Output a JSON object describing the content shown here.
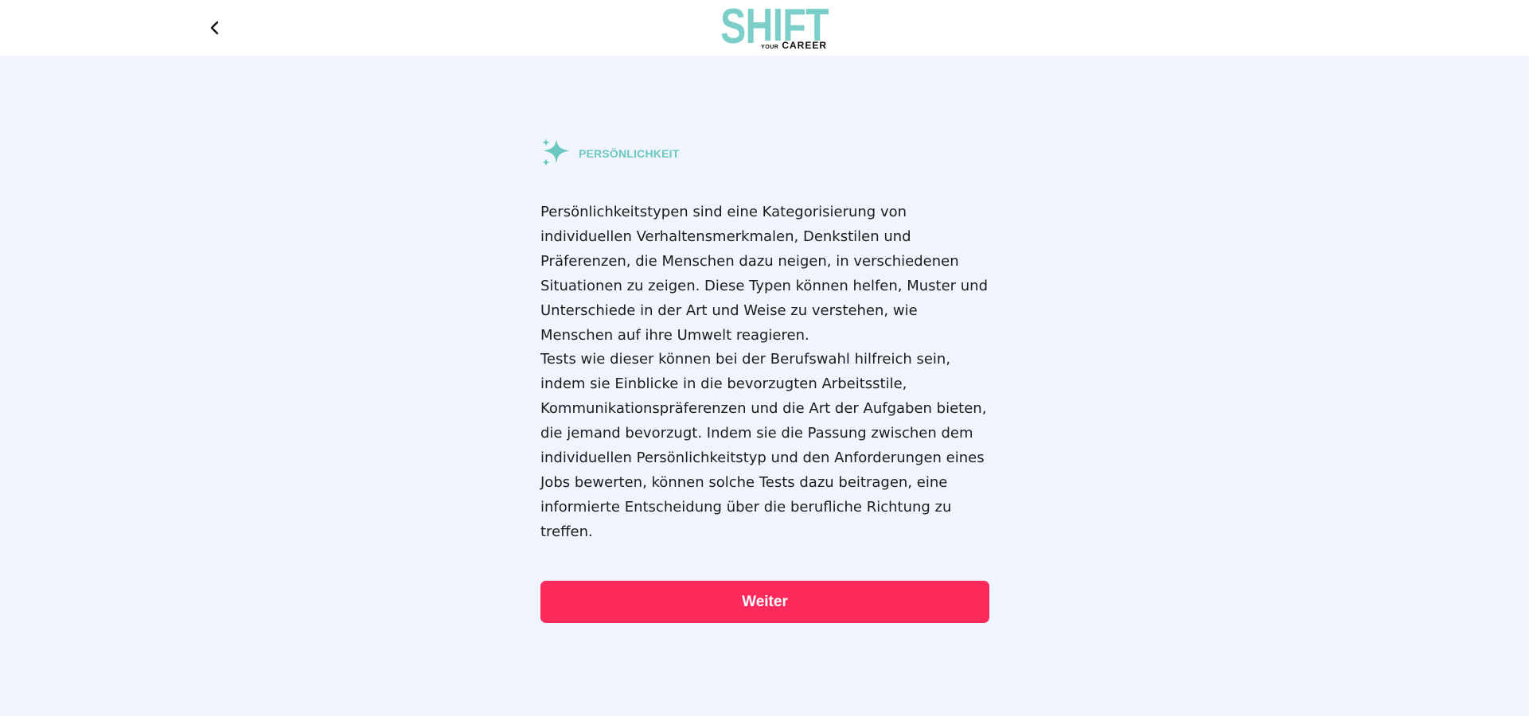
{
  "header": {
    "back_icon": "chevron-left-icon",
    "logo": {
      "main": "SHIFT",
      "sub_small": "YOUR",
      "sub_big": "CAREER",
      "color": "#7ccfc9"
    }
  },
  "section": {
    "icon": "sparkles-icon",
    "label": "PERSÖNLICHKEIT",
    "accent_color": "#6cc7c0"
  },
  "body": {
    "paragraph_1": "Persönlichkeitstypen sind eine Kategorisierung von individuellen Verhaltensmerkmalen, Denkstilen und Präferenzen, die Menschen dazu neigen, in verschiedenen Situationen zu zeigen. Diese Typen können helfen, Muster und Unterschiede in der Art und Weise zu verstehen, wie Menschen auf ihre Umwelt reagieren.",
    "paragraph_2": "Tests wie dieser können bei der Berufswahl hilfreich sein, indem sie Einblicke in die bevorzugten Arbeitsstile, Kommunikationspräferenzen und die Art der Aufgaben bieten, die jemand bevorzugt. Indem sie die Passung zwischen dem individuellen Persönlichkeitstyp und den Anforderungen eines Jobs bewerten, können solche Tests dazu beitragen, eine informierte Entscheidung über die berufliche Richtung zu treffen."
  },
  "cta": {
    "label": "Weiter",
    "color": "#ff2a5c"
  },
  "colors": {
    "page_background": "#f0f5fd",
    "header_background": "#ffffff"
  }
}
